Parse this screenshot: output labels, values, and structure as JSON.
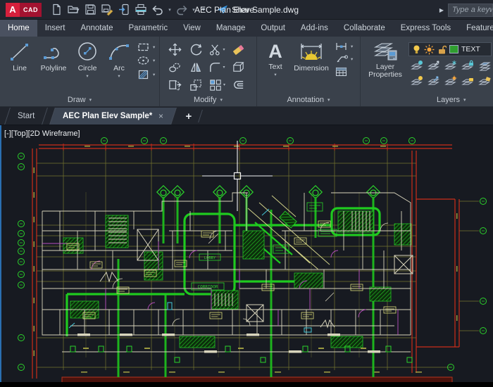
{
  "title_bar": {
    "logo_a": "A",
    "logo_cad": "CAD",
    "share_label": "Share",
    "document_title": "AEC Plan Elev Sample.dwg",
    "search_placeholder": "Type a keyw",
    "qat_icons": [
      "new-file",
      "open-file",
      "save",
      "save-as",
      "save-to-mobile",
      "plot",
      "undo",
      "redo",
      "customize"
    ]
  },
  "glyphs": {
    "caret_down": "▾",
    "play": "▶",
    "close": "×",
    "plus": "+"
  },
  "ribbon": {
    "tabs": [
      {
        "label": "Home"
      },
      {
        "label": "Insert"
      },
      {
        "label": "Annotate"
      },
      {
        "label": "Parametric"
      },
      {
        "label": "View"
      },
      {
        "label": "Manage"
      },
      {
        "label": "Output"
      },
      {
        "label": "Add-ins"
      },
      {
        "label": "Collaborate"
      },
      {
        "label": "Express Tools"
      },
      {
        "label": "Featured Apps"
      }
    ],
    "panels": {
      "draw": {
        "label": "Draw",
        "buttons": [
          "Line",
          "Polyline",
          "Circle",
          "Arc"
        ]
      },
      "modify": {
        "label": "Modify"
      },
      "annotation": {
        "label": "Annotation",
        "text_label": "Text",
        "dimension_label": "Dimension"
      },
      "layers": {
        "label": "Layers",
        "layer_properties_line1": "Layer",
        "layer_properties_line2": "Properties",
        "layer_combo_value": "TEXT"
      }
    }
  },
  "file_tabs": {
    "tabs": [
      {
        "label": "Start"
      },
      {
        "label": "AEC Plan Elev Sample*"
      }
    ]
  },
  "viewport": {
    "label": "[-][Top][2D Wireframe]"
  },
  "drawing": {
    "labels": {
      "corridor": "CORRIDOR",
      "lobby": "LOBBY"
    }
  },
  "colors": {
    "logo_red": "#d6203c",
    "share_blue": "#3d9be9",
    "cad_green": "#2bd42b",
    "cad_red": "#cc2d1a",
    "cad_olive": "#8a8a3a",
    "cad_yellow": "#dede7c",
    "cad_magenta": "#b94fc1",
    "canvas_bg": "#171a21",
    "ribbon_bg": "#3a414b"
  }
}
